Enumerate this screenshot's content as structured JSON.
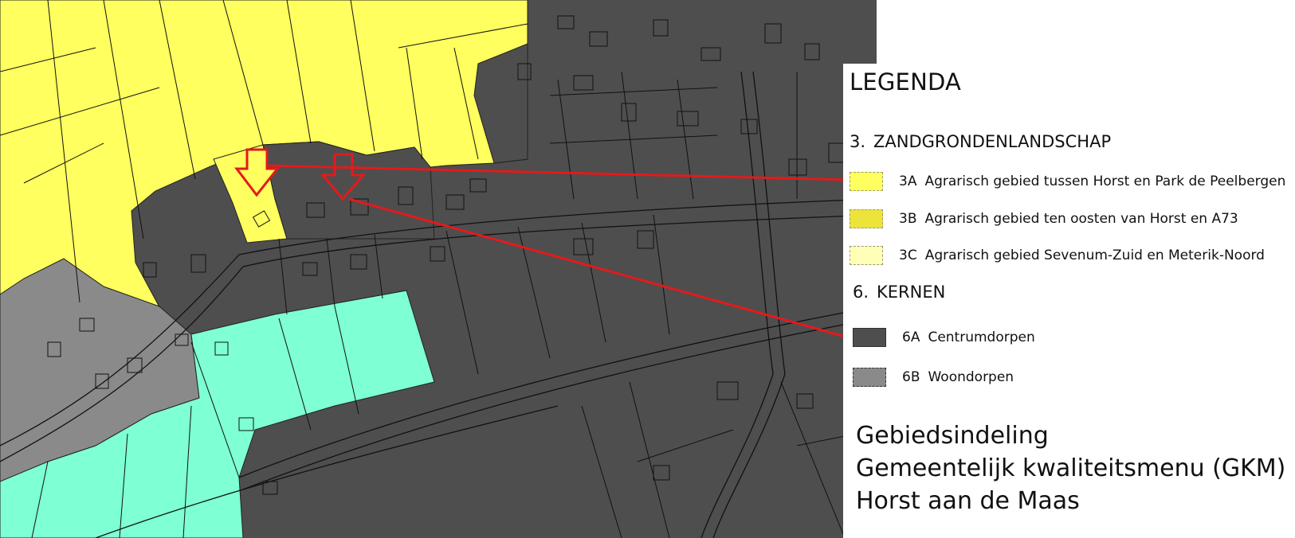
{
  "legend": {
    "title": "LEGENDA",
    "sections": [
      {
        "number": "3.",
        "title": "ZANDGRONDENLANDSCHAP",
        "items": [
          {
            "code": "3A",
            "label": "Agrarisch gebied tussen Horst en Park de Peelbergen",
            "color": "#ffff5f"
          },
          {
            "code": "3B",
            "label": "Agrarisch gebied ten oosten van Horst en A73",
            "color": "#ece43a"
          },
          {
            "code": "3C",
            "label": "Agrarisch gebied Sevenum-Zuid en Meterik-Noord",
            "color": "#ffffb8"
          }
        ]
      },
      {
        "number": "6.",
        "title": "KERNEN",
        "items": [
          {
            "code": "6A",
            "label": "Centrumdorpen",
            "color": "#4e4e4e"
          },
          {
            "code": "6B",
            "label": "Woondorpen",
            "color": "#8a8a8a"
          }
        ]
      }
    ]
  },
  "footer": {
    "line1": "Gebiedsindeling",
    "line2": "Gemeentelijk kwaliteitsmenu (GKM)",
    "line3": "Horst aan de Maas"
  },
  "map": {
    "colors": {
      "agrarisch_3a": "#ffff5f",
      "centrumdorpen_6a": "#4e4e4e",
      "woondorpen_6b": "#8a8a8a",
      "other_zone": "#7effd4",
      "parcel_line": "#111111",
      "annotation": "#e31a1c"
    },
    "annotations": [
      {
        "type": "arrow-marker",
        "points_to": "3A"
      },
      {
        "type": "arrow-marker",
        "points_to": "6A"
      }
    ]
  }
}
